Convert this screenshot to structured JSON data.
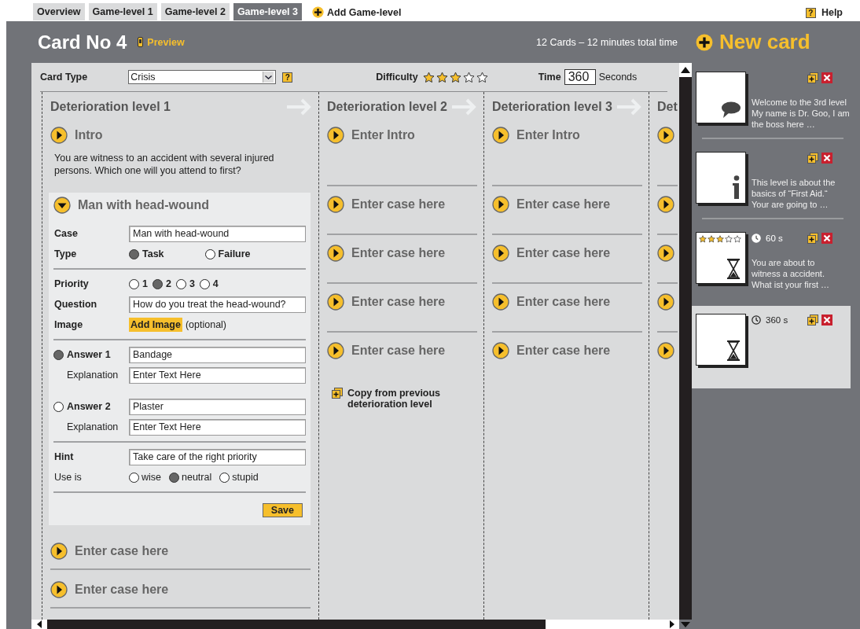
{
  "tabs": [
    {
      "label": "Overview",
      "selected": false
    },
    {
      "label": "Game-level 1",
      "selected": false
    },
    {
      "label": "Game-level 2",
      "selected": false
    },
    {
      "label": "Game-level 3",
      "selected": true
    }
  ],
  "add_level": "Add Game-level",
  "help": {
    "icon": "?",
    "label": "Help"
  },
  "card": {
    "title": "Card No 4",
    "preview": "Preview",
    "summary": "12 Cards – 12 minutes total time"
  },
  "new_card": "New card",
  "editor": {
    "card_type": {
      "label": "Card Type",
      "value": "Crisis",
      "help_icon": "?"
    },
    "difficulty": {
      "label": "Difficulty",
      "stars": 3
    },
    "time": {
      "label": "Time",
      "value": "360",
      "unit": "Seconds"
    },
    "columns": [
      {
        "title": "Deterioration level 1",
        "intro": {
          "label": "Intro",
          "text": "You are witness to an accident with several injured persons. Which one will you attend to first?",
          "expanded": false
        },
        "cases": [
          {
            "label": "Man with head-wound",
            "expanded": true
          },
          {
            "label": "Enter case here",
            "expanded": false
          },
          {
            "label": "Enter case here",
            "expanded": false
          }
        ]
      },
      {
        "title": "Deterioration level 2",
        "intro": {
          "label": "Enter Intro",
          "expanded": false
        },
        "cases": [
          {
            "label": "Enter case here",
            "expanded": false
          },
          {
            "label": "Enter case here",
            "expanded": false
          },
          {
            "label": "Enter case here",
            "expanded": false
          },
          {
            "label": "Enter case here",
            "expanded": false
          }
        ],
        "copy_link": "Copy from previous deterioration level"
      },
      {
        "title": "Deterioration level 3",
        "intro": {
          "label": "Enter Intro",
          "expanded": false
        },
        "cases": [
          {
            "label": "Enter case here",
            "expanded": false
          },
          {
            "label": "Enter case here",
            "expanded": false
          },
          {
            "label": "Enter case here",
            "expanded": false
          },
          {
            "label": "Enter case here",
            "expanded": false
          }
        ]
      },
      {
        "title": "Det",
        "intro": {
          "expanded": false
        },
        "cases": [
          {
            "expanded": false
          },
          {
            "expanded": false
          },
          {
            "expanded": false
          },
          {
            "expanded": false
          }
        ]
      }
    ],
    "case_form": {
      "case": {
        "label": "Case",
        "value": "Man with head-wound"
      },
      "type": {
        "label": "Type",
        "options": [
          {
            "label": "Task",
            "selected": true
          },
          {
            "label": "Failure",
            "selected": false
          }
        ]
      },
      "priority": {
        "label": "Priority",
        "options": [
          {
            "label": "1",
            "selected": false
          },
          {
            "label": "2",
            "selected": true
          },
          {
            "label": "3",
            "selected": false
          },
          {
            "label": "4",
            "selected": false
          }
        ]
      },
      "question": {
        "label": "Question",
        "value": "How do you treat the head-wound?"
      },
      "image": {
        "label": "Image",
        "button": "Add Image",
        "note": "(optional)"
      },
      "answers": [
        {
          "label": "Answer 1",
          "selected": true,
          "value": "Bandage",
          "explanation_label": "Explanation",
          "explanation_placeholder": "Enter Text Here"
        },
        {
          "label": "Answer 2",
          "selected": false,
          "value": "Plaster",
          "explanation_label": "Explanation",
          "explanation_placeholder": "Enter Text Here"
        }
      ],
      "hint": {
        "label": "Hint",
        "value": "Take care of the right priority"
      },
      "use": {
        "label": "Use is",
        "options": [
          {
            "label": "wise",
            "selected": false
          },
          {
            "label": "neutral",
            "selected": true
          },
          {
            "label": "stupid",
            "selected": false
          }
        ]
      },
      "save": "Save"
    }
  },
  "cards": [
    {
      "kind": "speech",
      "selected": false,
      "text": "Welcome to the 3rd level\nMy name is Dr. Goo, I am\nthe boss here …"
    },
    {
      "kind": "info",
      "selected": false,
      "text": "This level is about the\nbasics of “First Aid.“\nYour are going to …"
    },
    {
      "kind": "timer",
      "selected": false,
      "stars": 3,
      "time": "60 s",
      "text": "You are about to\nwitness a accident.\nWhat ist your first …"
    },
    {
      "kind": "timer",
      "selected": true,
      "time": "360 s"
    }
  ]
}
